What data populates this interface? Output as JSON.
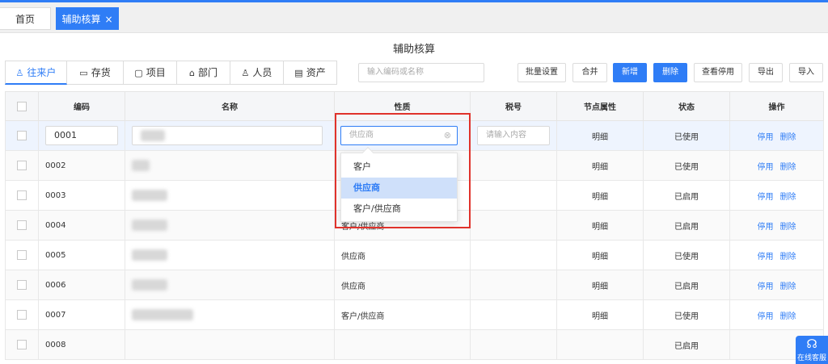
{
  "tabs": {
    "home": "首页",
    "active": "辅助核算",
    "close": "×"
  },
  "page_title": "辅助核算",
  "categories": [
    {
      "icon": "user-icon",
      "glyph": "♙",
      "label": "往来户"
    },
    {
      "icon": "inventory-icon",
      "glyph": "▭",
      "label": "存货"
    },
    {
      "icon": "folder-icon",
      "glyph": "▢",
      "label": "项目"
    },
    {
      "icon": "department-icon",
      "glyph": "⌂",
      "label": "部门"
    },
    {
      "icon": "person-icon",
      "glyph": "♙",
      "label": "人员"
    },
    {
      "icon": "asset-icon",
      "glyph": "▤",
      "label": "资产"
    }
  ],
  "search": {
    "placeholder": "输入编码或名称"
  },
  "toolbar": {
    "batch": "批量设置",
    "merge": "合并",
    "add": "新增",
    "delete": "删除",
    "view_disabled": "查看停用",
    "export": "导出",
    "import": "导入"
  },
  "columns": [
    "编码",
    "名称",
    "性质",
    "税号",
    "节点属性",
    "状态",
    "操作"
  ],
  "edit_row": {
    "code": "0001",
    "nature_placeholder": "供应商",
    "tax_placeholder": "请输入内容",
    "node": "明细",
    "status": "已使用",
    "action1": "停用",
    "action2": "删除"
  },
  "rows": [
    {
      "code": "0002",
      "nature": "",
      "node": "明细",
      "status": "已使用",
      "a1": "停用",
      "a2": "删除"
    },
    {
      "code": "0003",
      "nature": "",
      "node": "明细",
      "status": "已启用",
      "a1": "停用",
      "a2": "删除"
    },
    {
      "code": "0004",
      "nature": "客户/供应商",
      "node": "明细",
      "status": "已启用",
      "a1": "停用",
      "a2": "删除"
    },
    {
      "code": "0005",
      "nature": "供应商",
      "node": "明细",
      "status": "已使用",
      "a1": "停用",
      "a2": "删除"
    },
    {
      "code": "0006",
      "nature": "供应商",
      "node": "明细",
      "status": "已启用",
      "a1": "停用",
      "a2": "删除"
    },
    {
      "code": "0007",
      "nature": "客户/供应商",
      "node": "明细",
      "status": "已使用",
      "a1": "停用",
      "a2": "删除"
    },
    {
      "code": "0008",
      "nature": "",
      "node": "",
      "status": "已启用",
      "a1": "",
      "a2": ""
    }
  ],
  "dropdown": {
    "options": [
      "客户",
      "供应商",
      "客户/供应商"
    ],
    "selected": "供应商"
  },
  "service": {
    "icon": "headset-icon",
    "label": "在线客服"
  },
  "colors": {
    "primary": "#2f7df6",
    "highlight_box": "#e0322b"
  }
}
